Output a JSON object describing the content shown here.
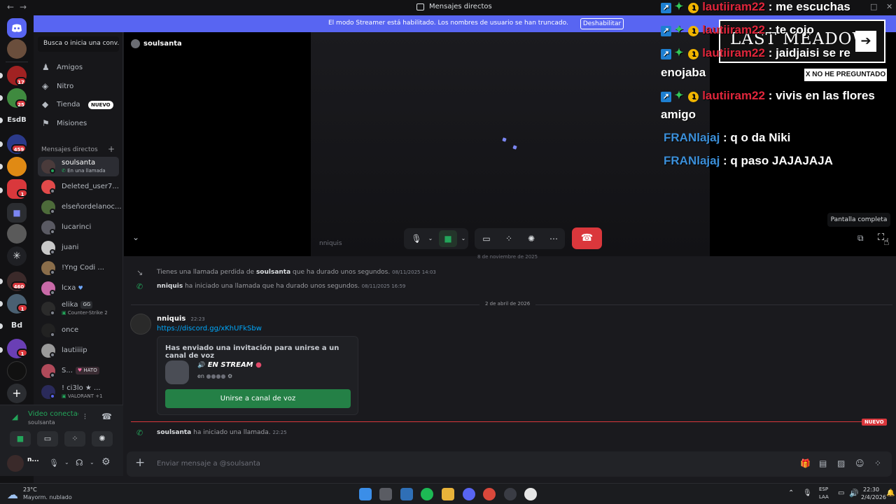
{
  "window": {
    "title": "Mensajes directos"
  },
  "banner": {
    "text": "El modo Streamer está habilitado. Los nombres de usuario se han truncado.",
    "button": "Deshabilitar"
  },
  "servers": {
    "badges": [
      "17",
      "25",
      "459",
      "1",
      "460",
      "1",
      "1"
    ],
    "labels": [
      "EsdB",
      "Bd"
    ]
  },
  "dm_panel": {
    "search_placeholder": "Busca o inicia una conv...",
    "nav": [
      {
        "label": "Amigos",
        "icon": "friends-icon"
      },
      {
        "label": "Nitro",
        "icon": "nitro-icon"
      },
      {
        "label": "Tienda",
        "icon": "shop-icon",
        "badge": "NUEVO"
      },
      {
        "label": "Misiones",
        "icon": "quests-icon"
      }
    ],
    "header": "Mensajes directos",
    "dms": [
      {
        "name": "soulsanta",
        "sub": "En una llamada",
        "active": true
      },
      {
        "name": "Deleted_user7..."
      },
      {
        "name": "elseñordelanoc..."
      },
      {
        "name": "lucarinci"
      },
      {
        "name": "juani"
      },
      {
        "name": "!Yng Codi ..."
      },
      {
        "name": "lcxa"
      },
      {
        "name": "elika",
        "chip": "GG",
        "sub": "Counter-Strike 2"
      },
      {
        "name": "once"
      },
      {
        "name": "lautiiiip"
      },
      {
        "name": "S...",
        "chip": "HATO"
      },
      {
        "name": "! ci3lo ★ ...",
        "sub": "VALORANT +1"
      }
    ]
  },
  "voice_panel": {
    "status": "Video conectado",
    "channel": "soulsanta",
    "user_initial": "n..."
  },
  "call": {
    "title": "soulsanta",
    "tile_name": "nniquis",
    "tooltip": "Pantalla completa"
  },
  "chat": {
    "date_cut": "8 de noviembre de 2025",
    "missed": {
      "pre": "Tienes una llamada perdida de ",
      "user": "soulsanta",
      "post": " que ha durado unos segundos.",
      "time": "08/11/2025 14:03"
    },
    "started1": {
      "user": "nniquis",
      "post": " ha iniciado una llamada que ha durado unos segundos.",
      "time": "08/11/2025 16:59"
    },
    "date_divider": "2 de abril de 2026",
    "message": {
      "author": "nniquis",
      "time": "22:23",
      "link": "https://discord.gg/xKhUFkSbw"
    },
    "invite": {
      "heading": "Has enviado una invitación para unirse a un canal de voz",
      "server": "EN STREAM",
      "in_text": "en",
      "button": "Unirse a canal de voz"
    },
    "new_label": "NUEVO",
    "started2": {
      "user": "soulsanta",
      "post": " ha iniciado una llamada.",
      "time": "22:25"
    }
  },
  "composer": {
    "placeholder": "Enviar mensaje a @soulsanta"
  },
  "overlay": {
    "messages": [
      {
        "user": "lautiiram22",
        "text": ": me escuchas",
        "badges": true,
        "color": "red"
      },
      {
        "user": "lautiiram22",
        "text": ": te cojo",
        "badges": true,
        "color": "red"
      },
      {
        "user": "lautiiram22",
        "text": ": jaidjaisi se re",
        "text2": "enojaba",
        "badges": true,
        "color": "red"
      },
      {
        "user": "lautiiram22",
        "text": ": vivis en las flores",
        "text2": "amigo",
        "badges": true,
        "color": "red"
      },
      {
        "user": "FRANlajaj",
        "text": ": q o da Niki",
        "badges": false,
        "color": "blue"
      },
      {
        "user": "FRANlajaj",
        "text": ": q paso JAJAJAJA",
        "badges": false,
        "color": "blue"
      }
    ],
    "logo": "LAST MEADOW",
    "tag": "X NO HE PREGUNTADO"
  },
  "taskbar": {
    "weather_temp": "23°C",
    "weather_desc": "Mayorm. nublado",
    "lang": "ESP",
    "lang2": "LAA",
    "time": "22:30",
    "date": "2/4/2026"
  },
  "colors": {
    "accent": "#5865f2",
    "danger": "#da373c",
    "online": "#23a55a"
  }
}
